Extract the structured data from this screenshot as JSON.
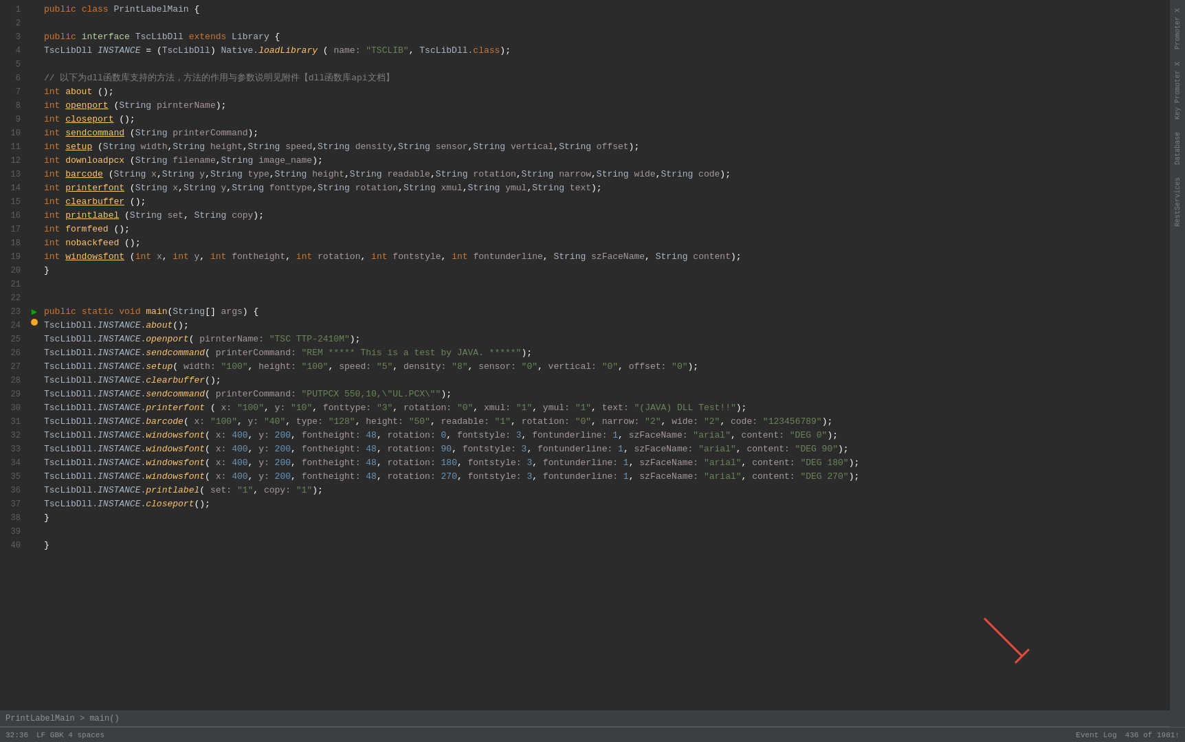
{
  "editor": {
    "breadcrumb": "PrintLabelMain > main()",
    "lines": [
      {
        "num": 1,
        "gutter": "",
        "code": "<span class='kw'>public</span> <span class='kw'>class</span> <span class='cls'>PrintLabelMain</span> <span class='white'>{</span>"
      },
      {
        "num": 2,
        "gutter": "",
        "code": ""
      },
      {
        "num": 3,
        "gutter": "",
        "code": "    <span class='kw'>public</span> <span class='iface'>interface</span> <span class='cls'>TscLibDll</span> <span class='extends-kw'>extends</span> <span class='cls'>Library</span> <span class='white'>{</span>"
      },
      {
        "num": 4,
        "gutter": "",
        "code": "        <span class='cls'>TscLibDll</span> <span class='instance italic'>INSTANCE</span> <span class='white'>=</span> <span class='white'>(</span><span class='cls'>TscLibDll</span><span class='white'>)</span> <span class='cls'>Native</span>.<span class='fn italic'>loadLibrary</span> <span class='white'>(</span> <span class='param-name'>name:</span> <span class='str'>\"TSCLIB\"</span><span class='white'>,</span> <span class='cls'>TscLibDll</span>.<span class='kw'>class</span><span class='white'>);</span>"
      },
      {
        "num": 5,
        "gutter": "",
        "code": ""
      },
      {
        "num": 6,
        "gutter": "",
        "code": "        <span class='comment'>// 以下为dll函数库支持的方法，方法的作用与参数说明见附件【dll函数库api文档】</span>"
      },
      {
        "num": 7,
        "gutter": "",
        "code": "        <span class='kw'>int</span> <span class='fn'>about</span> <span class='white'>();</span>"
      },
      {
        "num": 8,
        "gutter": "",
        "code": "        <span class='kw'>int</span> <span class='fn underline'>openport</span> <span class='white'>(</span><span class='cls'>String</span> <span class='param-name'>pirnterName</span><span class='white'>);</span>"
      },
      {
        "num": 9,
        "gutter": "",
        "code": "        <span class='kw'>int</span> <span class='fn underline'>closeport</span> <span class='white'>();</span>"
      },
      {
        "num": 10,
        "gutter": "",
        "code": "        <span class='kw'>int</span> <span class='fn underline'>sendcommand</span> <span class='white'>(</span><span class='cls'>String</span> <span class='param-name'>printerCommand</span><span class='white'>);</span>"
      },
      {
        "num": 11,
        "gutter": "",
        "code": "        <span class='kw'>int</span> <span class='fn underline'>setup</span> <span class='white'>(</span><span class='cls'>String</span> <span class='param-name'>width</span><span class='white'>,</span><span class='cls'>String</span> <span class='param-name'>height</span><span class='white'>,</span><span class='cls'>String</span> <span class='param-name'>speed</span><span class='white'>,</span><span class='cls'>String</span> <span class='param-name'>density</span><span class='white'>,</span><span class='cls'>String</span> <span class='param-name'>sensor</span><span class='white'>,</span><span class='cls'>String</span> <span class='param-name'>vertical</span><span class='white'>,</span><span class='cls'>String</span> <span class='param-name'>offset</span><span class='white'>);</span>"
      },
      {
        "num": 12,
        "gutter": "",
        "code": "        <span class='kw'>int</span> <span class='fn'>downloadpcx</span> <span class='white'>(</span><span class='cls'>String</span> <span class='param-name'>filename</span><span class='white'>,</span><span class='cls'>String</span> <span class='param-name'>image_name</span><span class='white'>);</span>"
      },
      {
        "num": 13,
        "gutter": "",
        "code": "        <span class='kw'>int</span> <span class='fn underline'>barcode</span> <span class='white'>(</span><span class='cls'>String</span> <span class='param-name'>x</span><span class='white'>,</span><span class='cls'>String</span> <span class='param-name'>y</span><span class='white'>,</span><span class='cls'>String</span> <span class='param-name'>type</span><span class='white'>,</span><span class='cls'>String</span> <span class='param-name'>height</span><span class='white'>,</span><span class='cls'>String</span> <span class='param-name'>readable</span><span class='white'>,</span><span class='cls'>String</span> <span class='param-name'>rotation</span><span class='white'>,</span><span class='cls'>String</span> <span class='param-name'>narrow</span><span class='white'>,</span><span class='cls'>String</span> <span class='param-name'>wide</span><span class='white'>,</span><span class='cls'>String</span> <span class='param-name'>code</span><span class='white'>);</span>"
      },
      {
        "num": 14,
        "gutter": "",
        "code": "        <span class='kw'>int</span> <span class='fn underline'>printerfont</span> <span class='white'>(</span><span class='cls'>String</span> <span class='param-name'>x</span><span class='white'>,</span><span class='cls'>String</span> <span class='param-name'>y</span><span class='white'>,</span><span class='cls'>String</span> <span class='param-name'>fonttype</span><span class='white'>,</span><span class='cls'>String</span> <span class='param-name'>rotation</span><span class='white'>,</span><span class='cls'>String</span> <span class='param-name'>xmul</span><span class='white'>,</span><span class='cls'>String</span> <span class='param-name'>ymul</span><span class='white'>,</span><span class='cls'>String</span> <span class='param-name'>text</span><span class='white'>);</span>"
      },
      {
        "num": 15,
        "gutter": "",
        "code": "        <span class='kw'>int</span> <span class='fn underline'>clearbuffer</span> <span class='white'>();</span>"
      },
      {
        "num": 16,
        "gutter": "",
        "code": "        <span class='kw'>int</span> <span class='fn underline'>printlabel</span> <span class='white'>(</span><span class='cls'>String</span> <span class='param-name'>set</span><span class='white'>,</span> <span class='cls'>String</span> <span class='param-name'>copy</span><span class='white'>);</span>"
      },
      {
        "num": 17,
        "gutter": "",
        "code": "        <span class='kw'>int</span> <span class='fn'>formfeed</span> <span class='white'>();</span>"
      },
      {
        "num": 18,
        "gutter": "",
        "code": "        <span class='kw'>int</span> <span class='fn'>nobackfeed</span> <span class='white'>();</span>"
      },
      {
        "num": 19,
        "gutter": "",
        "code": "        <span class='kw'>int</span> <span class='fn underline'>windowsfont</span> <span class='white'>(</span><span class='kw'>int</span> <span class='param-name'>x</span><span class='white'>,</span> <span class='kw'>int</span> <span class='param-name'>y</span><span class='white'>,</span> <span class='kw'>int</span> <span class='param-name'>fontheight</span><span class='white'>,</span> <span class='kw'>int</span> <span class='param-name'>rotation</span><span class='white'>,</span> <span class='kw'>int</span> <span class='param-name'>fontstyle</span><span class='white'>,</span> <span class='kw'>int</span> <span class='param-name'>fontunderline</span><span class='white'>,</span> <span class='cls'>String</span> <span class='param-name'>szFaceName</span><span class='white'>,</span> <span class='cls'>String</span> <span class='param-name'>content</span><span class='white'>);</span>"
      },
      {
        "num": 20,
        "gutter": "",
        "code": "    <span class='white'>}</span>"
      },
      {
        "num": 21,
        "gutter": "",
        "code": ""
      },
      {
        "num": 22,
        "gutter": "",
        "code": ""
      },
      {
        "num": 23,
        "gutter": "run",
        "code": "    <span class='kw'>public</span> <span class='kw'>static</span> <span class='kw'>void</span> <span class='fn'>main</span><span class='white'>(</span><span class='cls'>String</span><span class='white'>[]</span> <span class='param-name'>args</span><span class='white'>)</span> <span class='white'>{</span>"
      },
      {
        "num": 24,
        "gutter": "bp",
        "code": "        <span class='cls'>TscLibDll</span>.<span class='instance italic'>INSTANCE</span>.<span class='fn italic'>about</span><span class='white'>();</span>"
      },
      {
        "num": 25,
        "gutter": "",
        "code": "        <span class='cls'>TscLibDll</span>.<span class='instance italic'>INSTANCE</span>.<span class='fn italic'>openport</span><span class='white'>(</span> <span class='param-name'>pirnterName:</span> <span class='str'>\"TSC TTP-2410M\"</span><span class='white'>);</span>"
      },
      {
        "num": 26,
        "gutter": "",
        "code": "        <span class='cls'>TscLibDll</span>.<span class='instance italic'>INSTANCE</span>.<span class='fn italic'>sendcommand</span><span class='white'>(</span> <span class='param-name'>printerCommand:</span> <span class='str'>\"REM ***** This is a test by JAVA. *****\"</span><span class='white'>);</span>"
      },
      {
        "num": 27,
        "gutter": "",
        "code": "        <span class='cls'>TscLibDll</span>.<span class='instance italic'>INSTANCE</span>.<span class='fn italic'>setup</span><span class='white'>(</span> <span class='param-name'>width:</span> <span class='str'>\"100\"</span><span class='white'>,</span> <span class='param-name'>height:</span> <span class='str'>\"100\"</span><span class='white'>,</span>  <span class='param-name'>speed:</span> <span class='str'>\"5\"</span><span class='white'>,</span> <span class='param-name'>density:</span> <span class='str'>\"8\"</span><span class='white'>,</span>  <span class='param-name'>sensor:</span> <span class='str'>\"0\"</span><span class='white'>,</span>  <span class='param-name'>vertical:</span> <span class='str'>\"0\"</span><span class='white'>,</span>   <span class='param-name'>offset:</span> <span class='str'>\"0\"</span><span class='white'>);</span>"
      },
      {
        "num": 28,
        "gutter": "",
        "code": "        <span class='cls'>TscLibDll</span>.<span class='instance italic'>INSTANCE</span>.<span class='fn italic'>clearbuffer</span><span class='white'>();</span>"
      },
      {
        "num": 29,
        "gutter": "",
        "code": "        <span class='cls'>TscLibDll</span>.<span class='instance italic'>INSTANCE</span>.<span class='fn italic'>sendcommand</span><span class='white'>(</span> <span class='param-name'>printerCommand:</span> <span class='str'>\"PUTPCX 550,10,\\\"UL.PCX\\\"\"</span><span class='white'>);</span>"
      },
      {
        "num": 30,
        "gutter": "",
        "code": "        <span class='cls'>TscLibDll</span>.<span class='instance italic'>INSTANCE</span>.<span class='fn italic'>printerfont</span> <span class='white'>(</span> <span class='param-name'>x:</span> <span class='str'>\"100\"</span><span class='white'>,</span> <span class='param-name'>y:</span> <span class='str'>\"10\"</span><span class='white'>,</span>  <span class='param-name'>fonttype:</span> <span class='str'>\"3\"</span><span class='white'>,</span> <span class='param-name'>rotation:</span> <span class='str'>\"0\"</span><span class='white'>,</span>  <span class='param-name'>xmul:</span> <span class='str'>\"1\"</span><span class='white'>,</span>  <span class='param-name'>ymul:</span> <span class='str'>\"1\"</span><span class='white'>,</span>  <span class='param-name'>text:</span> <span class='str'>\"(JAVA) DLL Test!!\"</span><span class='white'>);</span>"
      },
      {
        "num": 31,
        "gutter": "",
        "code": "        <span class='cls'>TscLibDll</span>.<span class='instance italic'>INSTANCE</span>.<span class='fn italic'>barcode</span><span class='white'>(</span> <span class='param-name'>x:</span> <span class='str'>\"100\"</span><span class='white'>,</span> <span class='param-name'>y:</span> <span class='str'>\"40\"</span><span class='white'>,</span>  <span class='param-name'>type:</span> <span class='str'>\"128\"</span><span class='white'>,</span>  <span class='param-name'>height:</span> <span class='str'>\"50\"</span><span class='white'>,</span>  <span class='param-name'>readable:</span> <span class='str'>\"1\"</span><span class='white'>,</span>  <span class='param-name'>rotation:</span> <span class='str'>\"0\"</span><span class='white'>,</span>  <span class='param-name'>narrow:</span> <span class='str'>\"2\"</span><span class='white'>,</span>  <span class='param-name'>wide:</span> <span class='str'>\"2\"</span><span class='white'>,</span>  <span class='param-name'>code:</span> <span class='str'>\"123456789\"</span><span class='white'>);</span>"
      },
      {
        "num": 32,
        "gutter": "",
        "code": "        <span class='cls'>TscLibDll</span>.<span class='instance italic'>INSTANCE</span>.<span class='fn italic'>windowsfont</span><span class='white'>(</span> <span class='param-name'>x:</span> <span class='num'>400</span><span class='white'>,</span>  <span class='param-name'>y:</span> <span class='num'>200</span><span class='white'>,</span>  <span class='param-name'>fontheight:</span> <span class='num'>48</span><span class='white'>,</span>  <span class='param-name'>rotation:</span> <span class='num'>0</span><span class='white'>,</span>  <span class='param-name'>fontstyle:</span> <span class='num'>3</span><span class='white'>,</span>  <span class='param-name'>fontunderline:</span> <span class='num'>1</span><span class='white'>,</span>   <span class='param-name'>szFaceName:</span> <span class='str'>\"arial\"</span><span class='white'>,</span>  <span class='param-name'>content:</span> <span class='str'>\"DEG 0\"</span><span class='white'>);</span>"
      },
      {
        "num": 33,
        "gutter": "",
        "code": "        <span class='cls'>TscLibDll</span>.<span class='instance italic'>INSTANCE</span>.<span class='fn italic'>windowsfont</span><span class='white'>(</span> <span class='param-name'>x:</span> <span class='num'>400</span><span class='white'>,</span>  <span class='param-name'>y:</span> <span class='num'>200</span><span class='white'>,</span>  <span class='param-name'>fontheight:</span> <span class='num'>48</span><span class='white'>,</span>  <span class='param-name'>rotation:</span> <span class='num'>90</span><span class='white'>,</span>  <span class='param-name'>fontstyle:</span> <span class='num'>3</span><span class='white'>,</span>  <span class='param-name'>fontunderline:</span> <span class='num'>1</span><span class='white'>,</span>   <span class='param-name'>szFaceName:</span> <span class='str'>\"arial\"</span><span class='white'>,</span>  <span class='param-name'>content:</span> <span class='str'>\"DEG 90\"</span><span class='white'>);</span>"
      },
      {
        "num": 34,
        "gutter": "",
        "code": "        <span class='cls'>TscLibDll</span>.<span class='instance italic'>INSTANCE</span>.<span class='fn italic'>windowsfont</span><span class='white'>(</span> <span class='param-name'>x:</span> <span class='num'>400</span><span class='white'>,</span>  <span class='param-name'>y:</span> <span class='num'>200</span><span class='white'>,</span>  <span class='param-name'>fontheight:</span> <span class='num'>48</span><span class='white'>,</span>  <span class='param-name'>rotation:</span> <span class='num'>180</span><span class='white'>,</span>  <span class='param-name'>fontstyle:</span> <span class='num'>3</span><span class='white'>,</span>  <span class='param-name'>fontunderline:</span> <span class='num'>1</span><span class='white'>,</span>   <span class='param-name'>szFaceName:</span> <span class='str'>\"arial\"</span><span class='white'>,</span>  <span class='param-name'>content:</span> <span class='str'>\"DEG 180\"</span><span class='white'>);</span>"
      },
      {
        "num": 35,
        "gutter": "",
        "code": "        <span class='cls'>TscLibDll</span>.<span class='instance italic'>INSTANCE</span>.<span class='fn italic'>windowsfont</span><span class='white'>(</span> <span class='param-name'>x:</span> <span class='num'>400</span><span class='white'>,</span>  <span class='param-name'>y:</span> <span class='num'>200</span><span class='white'>,</span>  <span class='param-name'>fontheight:</span> <span class='num'>48</span><span class='white'>,</span>  <span class='param-name'>rotation:</span> <span class='num'>270</span><span class='white'>,</span>  <span class='param-name'>fontstyle:</span> <span class='num'>3</span><span class='white'>,</span>  <span class='param-name'>fontunderline:</span> <span class='num'>1</span><span class='white'>,</span>   <span class='param-name'>szFaceName:</span> <span class='str'>\"arial\"</span><span class='white'>,</span>  <span class='param-name'>content:</span> <span class='str'>\"DEG 270\"</span><span class='white'>);</span>"
      },
      {
        "num": 36,
        "gutter": "",
        "code": "        <span class='cls'>TscLibDll</span>.<span class='instance italic'>INSTANCE</span>.<span class='fn italic'>printlabel</span><span class='white'>(</span> <span class='param-name'>set:</span> <span class='str'>\"1\"</span><span class='white'>,</span>  <span class='param-name'>copy:</span> <span class='str'>\"1\"</span><span class='white'>);</span>"
      },
      {
        "num": 37,
        "gutter": "",
        "code": "        <span class='cls'>TscLibDll</span>.<span class='instance italic'>INSTANCE</span>.<span class='fn italic'>closeport</span><span class='white'>();</span>"
      },
      {
        "num": 38,
        "gutter": "",
        "code": "    <span class='white'>}</span>"
      },
      {
        "num": 39,
        "gutter": "",
        "code": ""
      },
      {
        "num": 40,
        "gutter": "",
        "code": "<span class='white'>}</span>"
      }
    ]
  },
  "status_bar": {
    "position": "32:36",
    "encoding": "LF  GBK  4 spaces",
    "lines": "436 of 1981↑",
    "event_log": "Event Log"
  },
  "right_sidebar": {
    "tabs": [
      "Promoter X",
      "Key Promoter X",
      "Database",
      "RestServices"
    ]
  }
}
